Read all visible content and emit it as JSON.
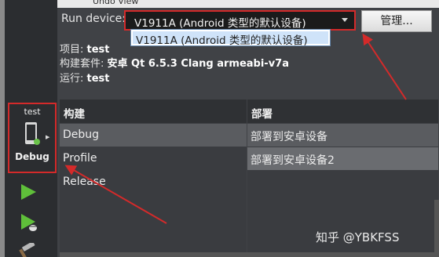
{
  "menu_hint": "Undo View",
  "kit": {
    "project": "test",
    "build": "Debug"
  },
  "run_device": {
    "label": "Run device:",
    "value": "V1911A (Android 类型的默认设备)",
    "dropdown_option": "V1911A (Android 类型的默认设备)"
  },
  "manage_label": "管理...",
  "info": [
    {
      "key": "项目: ",
      "value": "test"
    },
    {
      "key": "构建套件: ",
      "value": "安卓 Qt 6.5.3 Clang armeabi-v7a"
    },
    {
      "key": "运行: ",
      "value": "test"
    }
  ],
  "build": {
    "header": "构建",
    "items": [
      "Debug",
      "Profile",
      "Release"
    ]
  },
  "deploy": {
    "header": "部署",
    "items": [
      "部署到安卓设备",
      "部署到安卓设备2"
    ]
  },
  "watermark": "知乎 @YBKFSS",
  "colors": {
    "annotation": "#d42a2a",
    "accent": "#5a5c60"
  },
  "icons": [
    "android-device-icon",
    "run-icon",
    "debug-run-icon",
    "build-hammer-icon"
  ]
}
